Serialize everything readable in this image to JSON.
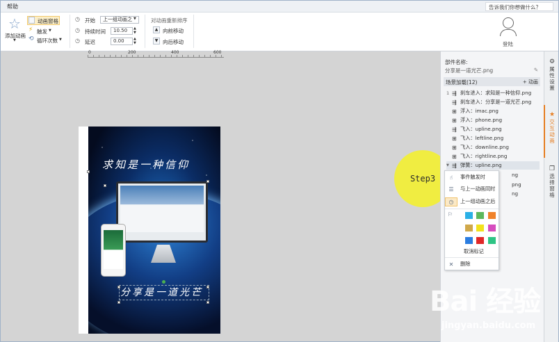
{
  "menu": {
    "help": "帮助",
    "tell_me": "告诉我们你想做什么？"
  },
  "ribbon": {
    "add_animation": "添加动画",
    "animation_pane": "动画窗格",
    "trigger": "触发",
    "loop_count": "循环次数",
    "start_label": "开始",
    "start_value": "上一组动画之",
    "duration_label": "持续时间",
    "duration_value": "10.50",
    "delay_label": "延迟",
    "delay_value": "0.00",
    "reorder_title": "对动画重新排序",
    "move_forward": "向前移动",
    "move_backward": "向后移动",
    "login": "登陆"
  },
  "ruler": {
    "ticks": [
      "0",
      "200",
      "400",
      "600"
    ]
  },
  "poster": {
    "line1": "求知是一种信仰",
    "line2": "分享是一道光芒"
  },
  "step_label": "Step3",
  "panel": {
    "component_name_label": "部件名称:",
    "component_name_value": "分享是一道光芒.png",
    "scene_loaded": "场景加载(12)",
    "add_animation": "+ 动画",
    "items": [
      {
        "num": "1",
        "label": "刹车进入：求知是一种信仰.png"
      },
      {
        "num": "",
        "label": "刹车进入：分享是一道光芒.png"
      },
      {
        "num": "",
        "label": "浮入：imac.png"
      },
      {
        "num": "",
        "label": "浮入：phone.png"
      },
      {
        "num": "",
        "label": "飞入：upline.png"
      },
      {
        "num": "",
        "label": "飞入：leftline.png"
      },
      {
        "num": "",
        "label": "飞入：downline.png"
      },
      {
        "num": "",
        "label": "飞入：rightline.png"
      },
      {
        "num": "",
        "label": "弹簧：upline.png"
      },
      {
        "num": "",
        "label": "ng"
      },
      {
        "num": "",
        "label": "png"
      },
      {
        "num": "",
        "label": "ng"
      }
    ]
  },
  "context_menu": {
    "on_event": "事件触发时",
    "with_previous": "与上一动画同时",
    "after_previous": "上一组动画之后",
    "swatches": [
      "#2ab0e6",
      "#5cb85c",
      "#f0822a",
      "#d0a84a",
      "#f2e21c",
      "#d64dbe",
      "#2b7de0",
      "#e02727",
      "#2ec484"
    ],
    "clear_marker": "取消标记",
    "delete": "删除"
  },
  "side_tabs": {
    "properties": "属性设置",
    "interaction": "交互动画",
    "selection": "选择窗格"
  },
  "watermark": {
    "logo": "Bai 经验",
    "url": "jingyan.baidu.com"
  }
}
